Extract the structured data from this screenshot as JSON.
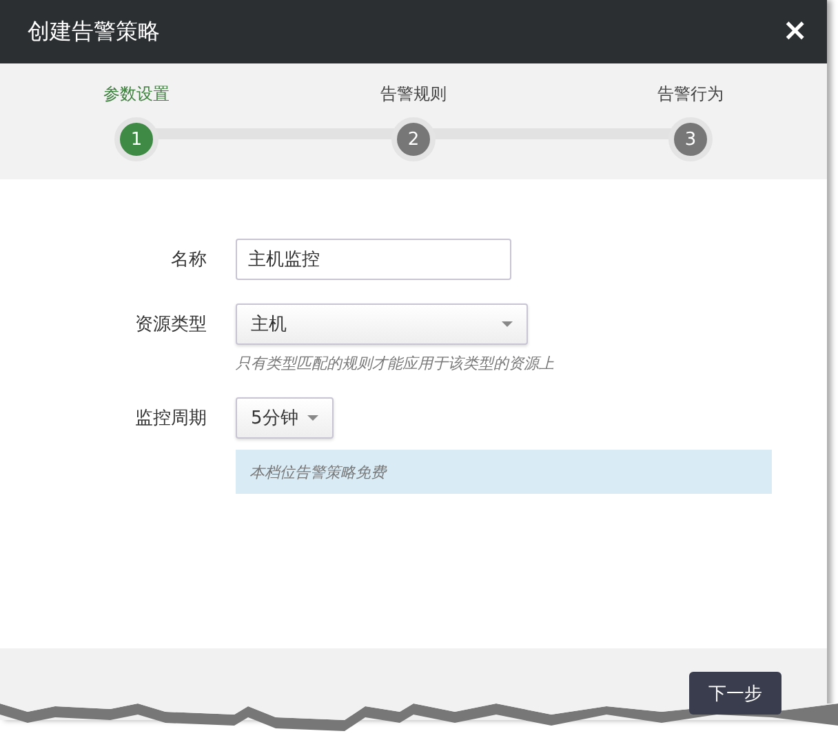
{
  "dialog": {
    "title": "创建告警策略",
    "close": "×"
  },
  "steps": [
    {
      "number": "1",
      "label": "参数设置",
      "selected": true
    },
    {
      "number": "2",
      "label": "告警规则",
      "selected": false
    },
    {
      "number": "3",
      "label": "告警行为",
      "selected": false
    }
  ],
  "fields": [
    {
      "kind": "text",
      "label": "名称",
      "value": "主机监控"
    },
    {
      "kind": "dropdown",
      "label": "资源类型",
      "value": "主机",
      "hint": "只有类型匹配的规则才能应用于该类型的资源上"
    },
    {
      "kind": "small-dropdown",
      "label": "监控周期",
      "value": "5分钟",
      "note": "本档位告警策略免费"
    }
  ],
  "footer": {
    "button": "下一步"
  }
}
